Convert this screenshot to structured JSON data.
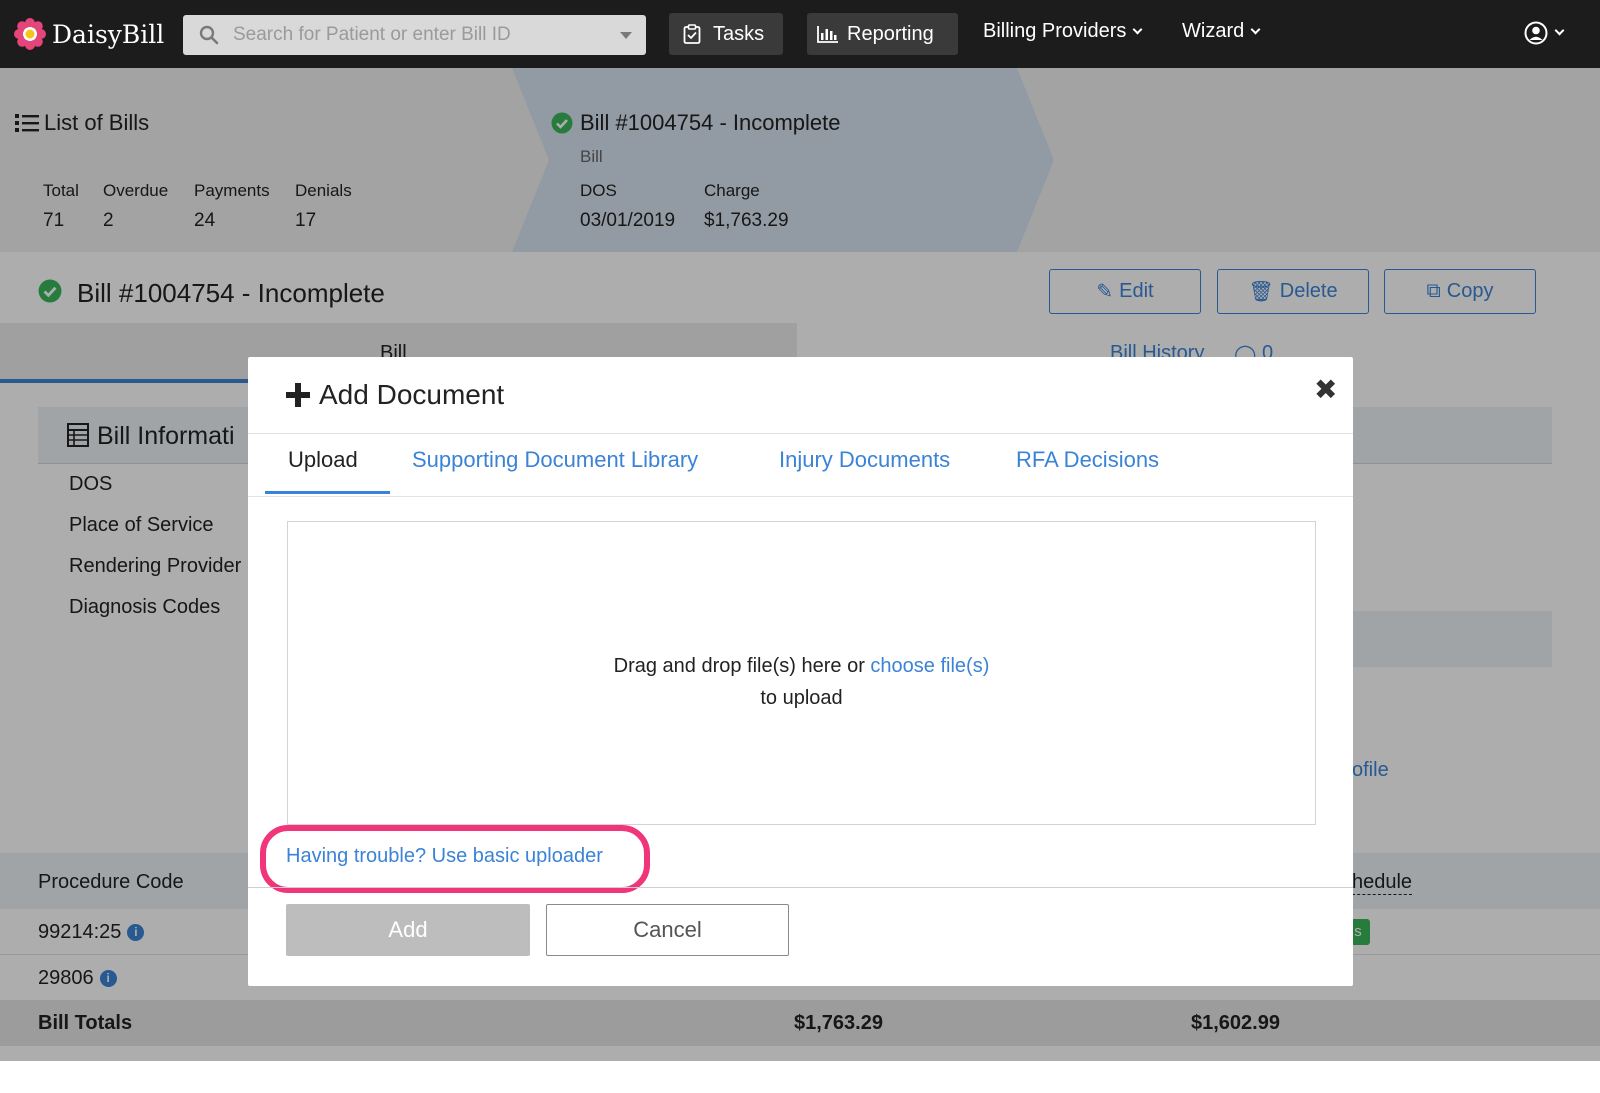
{
  "app": {
    "name": "DaisyBill"
  },
  "nav": {
    "search_placeholder": "Search for Patient or enter Bill ID",
    "tasks": "Tasks",
    "reporting": "Reporting",
    "billing_providers": "Billing Providers",
    "wizard": "Wizard"
  },
  "breadcrumb": {
    "list_title": "List of Bills",
    "stats": [
      {
        "label": "Total",
        "value": "71"
      },
      {
        "label": "Overdue",
        "value": "2"
      },
      {
        "label": "Payments",
        "value": "24"
      },
      {
        "label": "Denials",
        "value": "17"
      }
    ],
    "bill_title": "Bill #1004754 - Incomplete",
    "bill_sub": "Bill",
    "dos_label": "DOS",
    "dos_value": "03/01/2019",
    "charge_label": "Charge",
    "charge_value": "$1,763.29"
  },
  "page": {
    "title": "Bill #1004754 - Incomplete",
    "edit": "Edit",
    "delete": "Delete",
    "copy": "Copy",
    "tab_bill": "Bill",
    "tab_history": "Bill History",
    "history_count": "0",
    "section_title": "Bill Informati",
    "fields": [
      "DOS",
      "Place of Service",
      "Rendering Provider",
      "Diagnosis Codes"
    ],
    "profile_link": "ofile",
    "procedure_header": "Procedure Code",
    "schedule_header": "hedule",
    "badge_text": "s",
    "rows": [
      "99214:25",
      "29806"
    ],
    "totals_label": "Bill Totals",
    "totals_charge": "$1,763.29",
    "totals_schedule": "$1,602.99"
  },
  "modal": {
    "title": "Add Document",
    "tabs": [
      "Upload",
      "Supporting Document Library",
      "Injury Documents",
      "RFA Decisions"
    ],
    "active_tab": "Upload",
    "drop_text_1": "Drag and drop file(s) here or",
    "drop_link": "choose file(s)",
    "drop_text_2": "to upload",
    "trouble_link": "Having trouble? Use basic uploader",
    "add": "Add",
    "cancel": "Cancel"
  },
  "colors": {
    "accent": "#3b83d6",
    "highlight": "#f0357a",
    "success": "#3ab75b",
    "nav_bg": "#1c1c1c"
  }
}
